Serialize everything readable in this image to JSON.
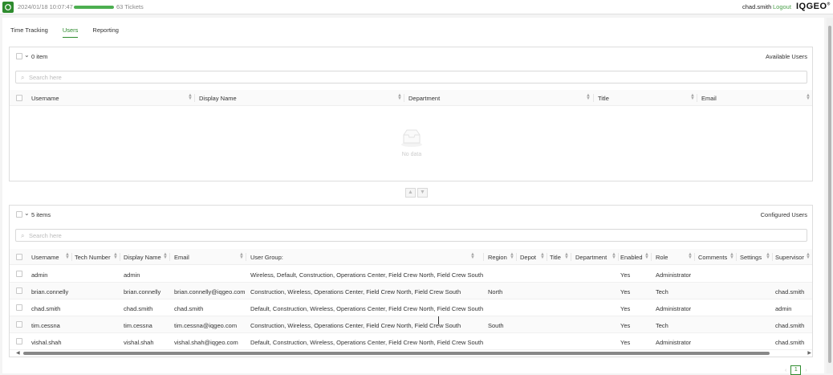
{
  "topbar": {
    "timestamp": "2024/01/18 10:07:47",
    "progress": 1.0,
    "tickets": "63 Tickets",
    "username": "chad.smith",
    "logout": "Logout",
    "brand": "IQGEO"
  },
  "tabs": [
    {
      "label": "Time Tracking",
      "active": false
    },
    {
      "label": "Users",
      "active": true
    },
    {
      "label": "Reporting",
      "active": false
    }
  ],
  "available": {
    "count": "0 item",
    "title": "Available Users",
    "search_placeholder": "Search here",
    "columns": [
      "Username",
      "Display Name",
      "Department",
      "Title",
      "Email"
    ],
    "empty_text": "No data"
  },
  "configured": {
    "count": "5 items",
    "title": "Configured Users",
    "search_placeholder": "Search here",
    "columns": [
      "Username",
      "Tech Number",
      "Display Name",
      "Email",
      "User Group:",
      "Region",
      "Depot",
      "Title",
      "Department",
      "Enabled",
      "Role",
      "Comments",
      "Settings",
      "Supervisor"
    ],
    "rows": [
      {
        "username": "admin",
        "tech": "",
        "display": "admin",
        "email": "",
        "group": "Wireless, Default, Construction, Operations Center, Field Crew North, Field Crew South",
        "region": "",
        "depot": "",
        "title": "",
        "department": "",
        "enabled": "Yes",
        "role": "Administrator",
        "comments": "",
        "settings": "",
        "supervisor": ""
      },
      {
        "username": "brian.connelly",
        "tech": "",
        "display": "brian.connelly",
        "email": "brian.connelly@iqgeo.com",
        "group": "Construction, Wireless, Operations Center, Field Crew North, Field Crew South",
        "region": "North",
        "depot": "",
        "title": "",
        "department": "",
        "enabled": "Yes",
        "role": "Tech",
        "comments": "",
        "settings": "",
        "supervisor": "chad.smith"
      },
      {
        "username": "chad.smith",
        "tech": "",
        "display": "chad.smith",
        "email": "chad.smith",
        "group": "Default, Construction, Wireless, Operations Center, Field Crew North, Field Crew South",
        "region": "",
        "depot": "",
        "title": "",
        "department": "",
        "enabled": "Yes",
        "role": "Administrator",
        "comments": "",
        "settings": "",
        "supervisor": "admin"
      },
      {
        "username": "tim.cessna",
        "tech": "",
        "display": "tim.cessna",
        "email": "tim.cessna@iqgeo.com",
        "group": "Construction, Wireless, Operations Center, Field Crew North, Field Crew South",
        "region": "South",
        "depot": "",
        "title": "",
        "department": "",
        "enabled": "Yes",
        "role": "Tech",
        "comments": "",
        "settings": "",
        "supervisor": "chad.smith"
      },
      {
        "username": "vishal.shah",
        "tech": "",
        "display": "vishal.shah",
        "email": "vishal.shah@iqgeo.com",
        "group": "Default, Construction, Wireless, Operations Center, Field Crew North, Field Crew South",
        "region": "",
        "depot": "",
        "title": "",
        "department": "",
        "enabled": "Yes",
        "role": "Administrator",
        "comments": "",
        "settings": "",
        "supervisor": "chad.smith"
      }
    ]
  },
  "pagination": {
    "page": "1"
  },
  "colors": {
    "accent": "#2e8b2e",
    "progress": "#4caf50"
  }
}
